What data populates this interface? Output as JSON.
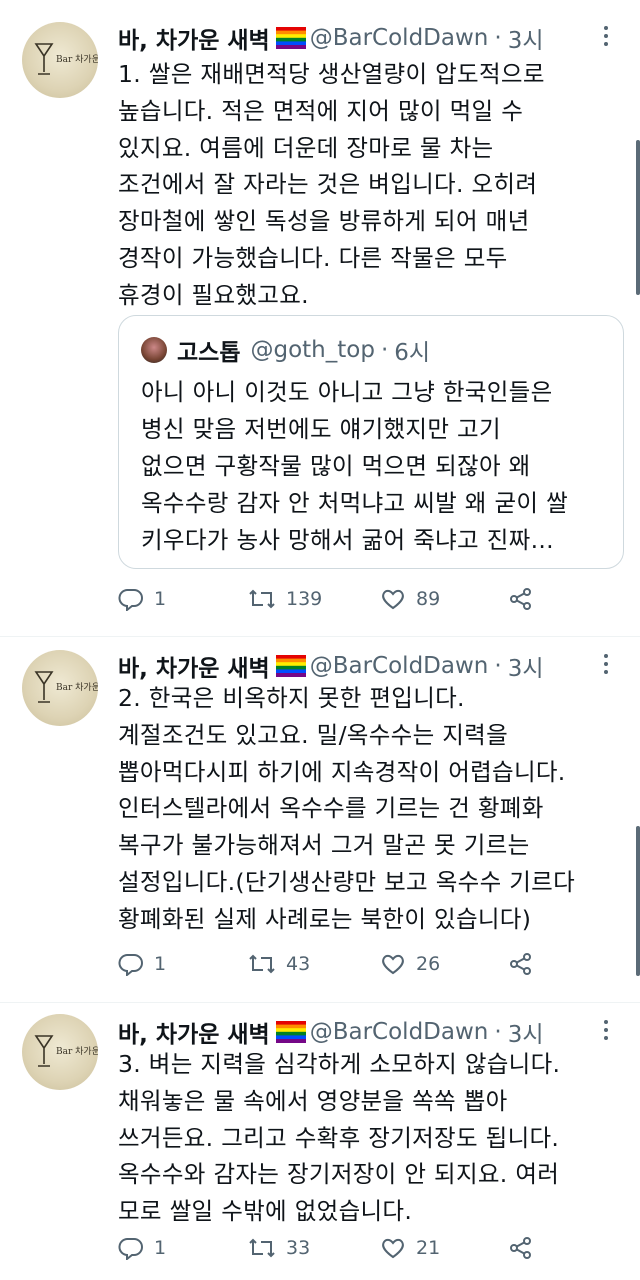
{
  "colors": {
    "muted": "#536471",
    "text": "#0f1419",
    "border": "#cfd9de"
  },
  "tweets": [
    {
      "name": "바, 차가운 새벽",
      "handle": "@BarColdDawn",
      "time": "3시",
      "lines": [
        "1. 쌀은 재배면적당 생산열량이 압도적으로",
        "높습니다. 적은 면적에 지어 많이 먹일 수",
        "있지요. 여름에 더운데 장마로 물 차는",
        "조건에서 잘 자라는 것은 벼입니다. 오히려",
        "장마철에 쌓인 독성을 방류하게 되어 매년",
        "경작이 가능했습니다. 다른 작물은 모두",
        "휴경이 필요했고요."
      ],
      "quote": {
        "name": "고스톱",
        "handle": "@goth_top",
        "time": "6시",
        "lines": [
          "아니 아니 이것도 아니고 그냥 한국인들은",
          "병신 맞음 저번에도 얘기했지만 고기",
          "없으면 구황작물 많이 먹으면 되잖아 왜",
          "옥수수랑 감자 안 처먹냐고 씨발 왜 굳이 쌀",
          "키우다가 농사 망해서 굶어 죽냐고 진짜..."
        ]
      },
      "replies": "1",
      "retweets": "139",
      "likes": "89"
    },
    {
      "name": "바, 차가운 새벽",
      "handle": "@BarColdDawn",
      "time": "3시",
      "lines": [
        "2. 한국은 비옥하지 못한 편입니다.",
        "계절조건도 있고요.  밀/옥수수는 지력을",
        "뽑아먹다시피 하기에 지속경작이 어렵습니다.",
        "인터스텔라에서 옥수수를 기르는 건 황폐화",
        "복구가 불가능해져서 그거 말곤 못 기르는",
        "설정입니다.(단기생산량만 보고 옥수수 기르다",
        "황폐화된 실제 사례로는 북한이 있습니다)"
      ],
      "replies": "1",
      "retweets": "43",
      "likes": "26"
    },
    {
      "name": "바, 차가운 새벽",
      "handle": "@BarColdDawn",
      "time": "3시",
      "lines": [
        "3. 벼는 지력을 심각하게 소모하지 않습니다.",
        "채워놓은 물 속에서 영양분을 쏙쏙 뽑아",
        "쓰거든요. 그리고 수확후 장기저장도 됩니다.",
        "옥수수와 감자는 장기저장이 안 되지요. 여러",
        "모로 쌀일 수밖에 없었습니다."
      ],
      "replies": "1",
      "retweets": "33",
      "likes": "21"
    }
  ]
}
